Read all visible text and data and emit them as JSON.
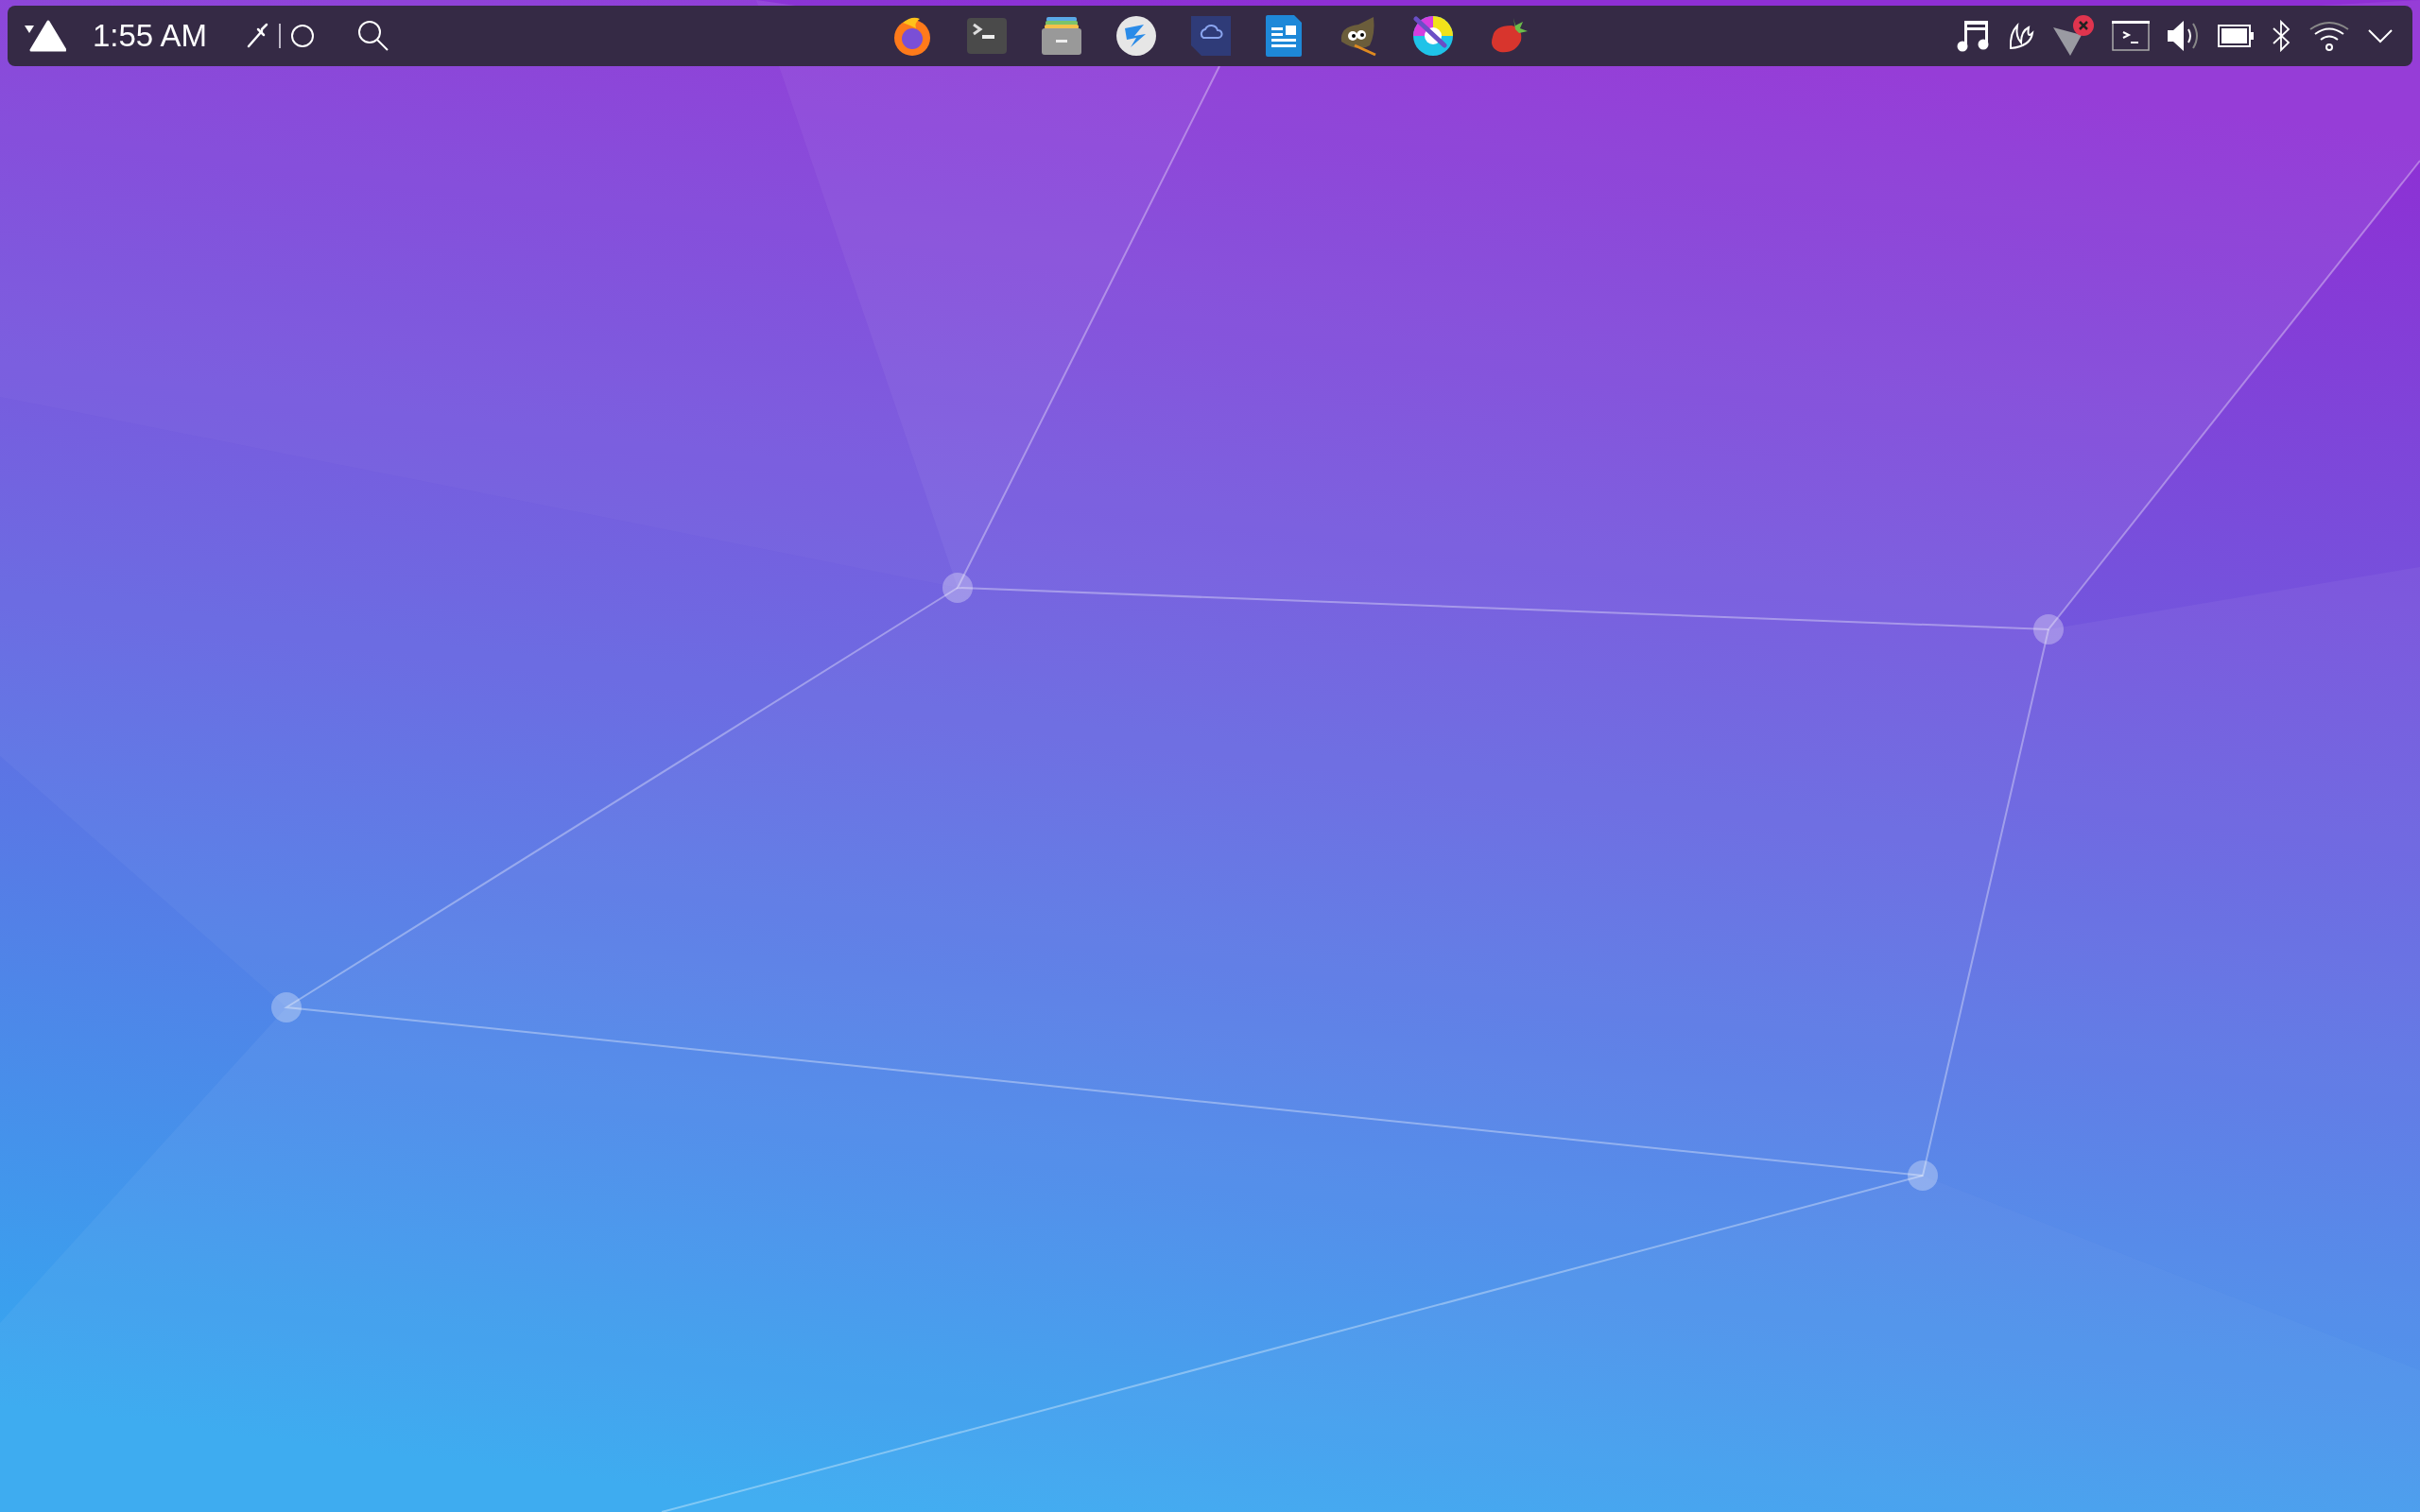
{
  "panel": {
    "clock": "1:55 AM"
  }
}
